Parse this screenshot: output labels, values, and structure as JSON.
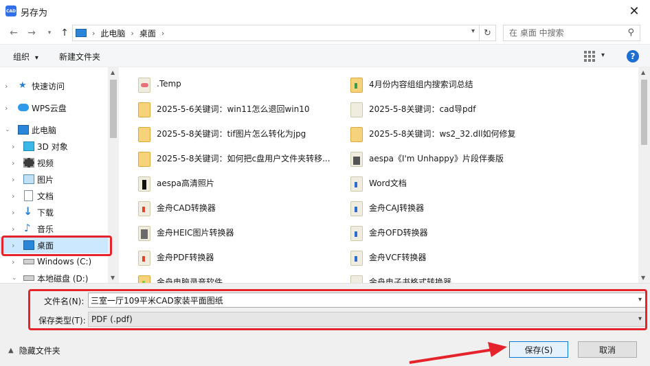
{
  "window": {
    "title": "另存为",
    "app_icon_text": "CAD"
  },
  "address": {
    "parts": [
      "此电脑",
      "桌面"
    ]
  },
  "search": {
    "placeholder": "在 桌面 中搜索"
  },
  "toolbar": {
    "organize": "组织",
    "new_folder": "新建文件夹",
    "help": "?"
  },
  "sidebar": {
    "items": [
      {
        "label": "快速访问",
        "icon": "star-icon"
      },
      {
        "label": "WPS云盘",
        "icon": "cloud-icon"
      },
      {
        "label": "此电脑",
        "icon": "computer-icon"
      },
      {
        "label": "3D 对象",
        "icon": "cube-icon"
      },
      {
        "label": "视频",
        "icon": "film-icon"
      },
      {
        "label": "图片",
        "icon": "picture-icon"
      },
      {
        "label": "文档",
        "icon": "document-icon"
      },
      {
        "label": "下载",
        "icon": "download-icon"
      },
      {
        "label": "音乐",
        "icon": "music-icon"
      },
      {
        "label": "桌面",
        "icon": "desktop-icon"
      },
      {
        "label": "Windows (C:)",
        "icon": "drive-icon"
      },
      {
        "label": "本地磁盘 (D:)",
        "icon": "drive-icon"
      }
    ]
  },
  "files": [
    {
      "name": ".Temp"
    },
    {
      "name": "4月份内容组组内搜索词总结"
    },
    {
      "name": "2025-5-6关键词：win11怎么退回win10"
    },
    {
      "name": "2025-5-8关键词：cad导pdf"
    },
    {
      "name": "2025-5-8关键词：tif图片怎么转化为jpg"
    },
    {
      "name": "2025-5-8关键词：ws2_32.dll如何修复"
    },
    {
      "name": "2025-5-8关键词：如何把c盘用户文件夹转移..."
    },
    {
      "name": "aespa《I'm Unhappy》片段伴奏版"
    },
    {
      "name": "aespa高清照片"
    },
    {
      "name": "Word文档"
    },
    {
      "name": "金舟CAD转换器"
    },
    {
      "name": "金舟CAJ转换器"
    },
    {
      "name": "金舟HEIC图片转换器"
    },
    {
      "name": "金舟OFD转换器"
    },
    {
      "name": "金舟PDF转换器"
    },
    {
      "name": "金舟VCF转换器"
    },
    {
      "name": "金舟电脑录音软件"
    },
    {
      "name": "金舟电子书格式转换器"
    }
  ],
  "form": {
    "filename_label": "文件名(N):",
    "filename_value": "三室一厅109平米CAD家装平面图纸",
    "filetype_label": "保存类型(T):",
    "filetype_value": "PDF (.pdf)"
  },
  "footer": {
    "hide_folders": "隐藏文件夹",
    "save": "保存(S)",
    "cancel": "取消"
  },
  "colors": {
    "annotation_red": "#e5232b",
    "selection": "#cce8ff",
    "accent": "#0078d7"
  }
}
